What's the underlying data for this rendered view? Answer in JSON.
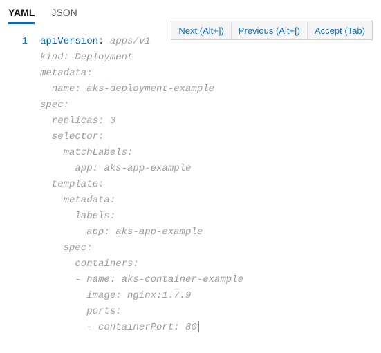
{
  "tabs": {
    "yaml": "YAML",
    "json": "JSON",
    "active": "yaml"
  },
  "suggest": {
    "next": "Next (Alt+])",
    "previous": "Previous (Alt+[)",
    "accept": "Accept (Tab)"
  },
  "gutter": {
    "line1": "1"
  },
  "code": {
    "key_apiVersion": "apiVersion",
    "val_apiVersion": "apps/v1",
    "line2": "kind: Deployment",
    "line3": "metadata:",
    "line4": "  name: aks-deployment-example",
    "line5": "spec:",
    "line6": "  replicas: 3",
    "line7": "  selector:",
    "line8": "    matchLabels:",
    "line9": "      app: aks-app-example",
    "line10": "  template:",
    "line11": "    metadata:",
    "line12": "      labels:",
    "line13": "        app: aks-app-example",
    "line14": "    spec:",
    "line15": "      containers:",
    "line16": "      - name: aks-container-example",
    "line17": "        image: nginx:1.7.9",
    "line18": "        ports:",
    "line19": "        - containerPort: 80"
  }
}
